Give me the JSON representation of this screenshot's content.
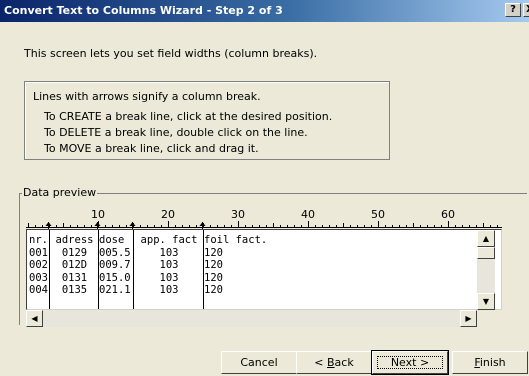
{
  "window": {
    "title": "Convert Text to Columns Wizard - Step 2 of 3",
    "help_glyph": "?",
    "close_glyph": "X"
  },
  "intro_text": "This screen lets you set field widths (column breaks).",
  "instructions": {
    "heading": "Lines with arrows signify a column break.",
    "create": "To CREATE a break line, click at the desired position.",
    "delete": "To DELETE a break line, double click on the line.",
    "move": "To MOVE a break line, click and drag it."
  },
  "preview": {
    "label": "Data preview",
    "ruler_labels": [
      "10",
      "20",
      "30",
      "40",
      "50",
      "60"
    ],
    "columns": [
      "nr.",
      "adress",
      "dose",
      "app. fact",
      "foil fact."
    ],
    "rows": [
      [
        "001",
        "0129",
        "005.5",
        "103",
        "120"
      ],
      [
        "002",
        "012D",
        "009.7",
        "103",
        "120"
      ],
      [
        "003",
        "0131",
        "015.0",
        "103",
        "120"
      ],
      [
        "004",
        "0135",
        "021.1",
        "103",
        "120"
      ]
    ],
    "scroll_up_glyph": "▲",
    "scroll_down_glyph": "▼",
    "scroll_left_glyph": "◀",
    "scroll_right_glyph": "▶"
  },
  "buttons": {
    "cancel": "Cancel",
    "back_prefix": "< ",
    "back_key": "B",
    "back_rest": "ack",
    "next": "Next >",
    "finish_key": "F",
    "finish_rest": "inish"
  }
}
